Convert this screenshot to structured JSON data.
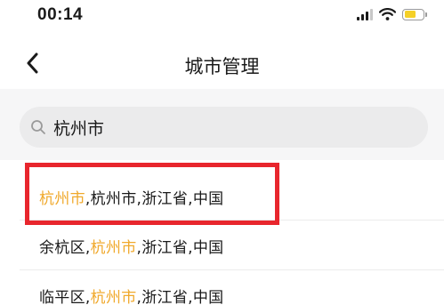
{
  "status_bar": {
    "time": "00:14",
    "icons": [
      "signal-icon",
      "wifi-icon",
      "battery-icon"
    ],
    "battery_level": 0.62,
    "battery_color": "#f5d027"
  },
  "nav": {
    "back_icon": "chevron-left-icon",
    "title": "城市管理"
  },
  "search": {
    "icon": "search-icon",
    "value": "杭州市"
  },
  "results": [
    {
      "parts": [
        {
          "text": "杭州市",
          "highlight": true
        },
        {
          "text": ",杭州市,浙江省,中国",
          "highlight": false
        }
      ]
    },
    {
      "parts": [
        {
          "text": "余杭区,",
          "highlight": false
        },
        {
          "text": "杭州市",
          "highlight": true
        },
        {
          "text": ",浙江省,中国",
          "highlight": false
        }
      ]
    },
    {
      "parts": [
        {
          "text": "临平区,",
          "highlight": false
        },
        {
          "text": "杭州市",
          "highlight": true
        },
        {
          "text": ",浙江省,中国",
          "highlight": false
        }
      ]
    }
  ],
  "colors": {
    "highlight": "#f0a92c",
    "annotation": "#e8262d",
    "background": "#f6f6f7"
  }
}
